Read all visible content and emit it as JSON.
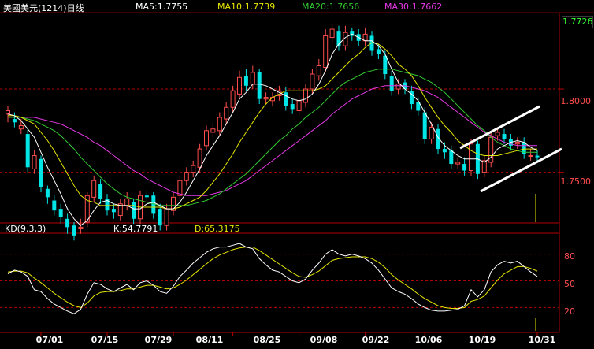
{
  "header": {
    "title": "美國美元(1214)日线",
    "ma5": "MA5:1.7755",
    "ma10": "MA10:1.7739",
    "ma20": "MA20:1.7656",
    "ma30": "MA30:1.7662"
  },
  "price_axis": {
    "current": "1.7726",
    "tick_1800": "1.8000",
    "tick_1750": "1.7500"
  },
  "kd_panel": {
    "title": "KD(9,3,3)",
    "k_text": "K:54.7791",
    "d_text": "D:65.3175",
    "ticks": [
      "80",
      "50",
      "20"
    ]
  },
  "x_ticks": [
    "07/01",
    "07/15",
    "07/29",
    "08/11",
    "08/25",
    "09/08",
    "09/22",
    "10/06",
    "10/19",
    "10/31"
  ],
  "colors": {
    "background": "#000000",
    "up": "#ff4d4d",
    "down": "#00e5e5",
    "ma5": "#ffffff",
    "ma10": "#e6e600",
    "ma20": "#33cc33",
    "ma30": "#e639e6",
    "grid": "#b40000"
  },
  "chart_data": [
    {
      "type": "candlestick",
      "title": "美國美元(1214)日线",
      "ylim": [
        1.72,
        1.845
      ],
      "yticks": [
        1.75,
        1.8
      ],
      "open": [
        1.785,
        1.782,
        1.776,
        1.773,
        1.752,
        1.758,
        1.74,
        1.733,
        1.728,
        1.722,
        1.718,
        1.716,
        1.72,
        1.735,
        1.743,
        1.734,
        1.728,
        1.724,
        1.73,
        1.732,
        1.722,
        1.736,
        1.736,
        1.728,
        1.718,
        1.727,
        1.736,
        1.745,
        1.75,
        1.753,
        1.766,
        1.774,
        1.775,
        1.782,
        1.789,
        1.797,
        1.808,
        1.803,
        1.81,
        1.794,
        1.793,
        1.796,
        1.798,
        1.791,
        1.787,
        1.792,
        1.8,
        1.808,
        1.813,
        1.831,
        1.835,
        1.826,
        1.835,
        1.833,
        1.829,
        1.832,
        1.824,
        1.82,
        1.808,
        1.8,
        1.804,
        1.799,
        1.792,
        1.786,
        1.77,
        1.776,
        1.764,
        1.763,
        1.755,
        1.755,
        1.751,
        1.767,
        1.75,
        1.756,
        1.772,
        1.773,
        1.77,
        1.767,
        1.768,
        1.76,
        1.76
      ],
      "close": [
        1.787,
        1.78,
        1.778,
        1.753,
        1.76,
        1.741,
        1.735,
        1.727,
        1.723,
        1.717,
        1.712,
        1.717,
        1.736,
        1.745,
        1.734,
        1.727,
        1.726,
        1.731,
        1.734,
        1.722,
        1.736,
        1.735,
        1.725,
        1.718,
        1.728,
        1.735,
        1.745,
        1.75,
        1.754,
        1.764,
        1.775,
        1.776,
        1.783,
        1.789,
        1.799,
        1.807,
        1.802,
        1.81,
        1.794,
        1.795,
        1.795,
        1.799,
        1.79,
        1.788,
        1.793,
        1.8,
        1.809,
        1.814,
        1.832,
        1.836,
        1.826,
        1.834,
        1.832,
        1.829,
        1.833,
        1.823,
        1.821,
        1.809,
        1.799,
        1.803,
        1.8,
        1.791,
        1.787,
        1.77,
        1.777,
        1.764,
        1.762,
        1.755,
        1.756,
        1.751,
        1.767,
        1.749,
        1.757,
        1.771,
        1.774,
        1.77,
        1.766,
        1.768,
        1.761,
        1.76,
        1.759
      ],
      "high": [
        1.79,
        1.786,
        1.782,
        1.776,
        1.763,
        1.76,
        1.742,
        1.736,
        1.731,
        1.725,
        1.72,
        1.722,
        1.738,
        1.748,
        1.746,
        1.737,
        1.731,
        1.734,
        1.738,
        1.734,
        1.739,
        1.739,
        1.738,
        1.731,
        1.731,
        1.738,
        1.748,
        1.753,
        1.757,
        1.767,
        1.778,
        1.78,
        1.786,
        1.792,
        1.802,
        1.811,
        1.812,
        1.814,
        1.812,
        1.798,
        1.798,
        1.802,
        1.801,
        1.794,
        1.796,
        1.803,
        1.812,
        1.818,
        1.836,
        1.839,
        1.838,
        1.838,
        1.837,
        1.836,
        1.837,
        1.835,
        1.827,
        1.823,
        1.811,
        1.806,
        1.806,
        1.802,
        1.795,
        1.789,
        1.78,
        1.779,
        1.768,
        1.766,
        1.759,
        1.759,
        1.77,
        1.769,
        1.76,
        1.774,
        1.777,
        1.776,
        1.773,
        1.771,
        1.771,
        1.764,
        1.763
      ],
      "low": [
        1.78,
        1.777,
        1.773,
        1.75,
        1.749,
        1.738,
        1.731,
        1.724,
        1.719,
        1.713,
        1.709,
        1.713,
        1.717,
        1.732,
        1.731,
        1.724,
        1.722,
        1.721,
        1.727,
        1.719,
        1.719,
        1.732,
        1.722,
        1.715,
        1.715,
        1.724,
        1.733,
        1.742,
        1.747,
        1.75,
        1.763,
        1.771,
        1.772,
        1.779,
        1.786,
        1.794,
        1.799,
        1.8,
        1.791,
        1.791,
        1.79,
        1.793,
        1.787,
        1.785,
        1.784,
        1.789,
        1.797,
        1.805,
        1.81,
        1.828,
        1.823,
        1.823,
        1.829,
        1.826,
        1.826,
        1.82,
        1.818,
        1.806,
        1.796,
        1.797,
        1.797,
        1.788,
        1.784,
        1.767,
        1.767,
        1.761,
        1.758,
        1.752,
        1.752,
        1.748,
        1.748,
        1.746,
        1.747,
        1.753,
        1.769,
        1.767,
        1.763,
        1.764,
        1.758,
        1.757,
        1.756
      ],
      "ma5": [
        1.785,
        1.784,
        1.781,
        1.776,
        1.771,
        1.762,
        1.753,
        1.745,
        1.737,
        1.728,
        1.722,
        1.718,
        1.721,
        1.727,
        1.732,
        1.733,
        1.731,
        1.73,
        1.73,
        1.728,
        1.728,
        1.731,
        1.732,
        1.73,
        1.728,
        1.728,
        1.732,
        1.738,
        1.745,
        1.752,
        1.76,
        1.766,
        1.772,
        1.779,
        1.786,
        1.794,
        1.798,
        1.803,
        1.803,
        1.802,
        1.8,
        1.798,
        1.796,
        1.794,
        1.793,
        1.794,
        1.797,
        1.803,
        1.811,
        1.821,
        1.827,
        1.831,
        1.833,
        1.831,
        1.829,
        1.829,
        1.826,
        1.821,
        1.812,
        1.804,
        1.8,
        1.797,
        1.793,
        1.786,
        1.779,
        1.771,
        1.766,
        1.763,
        1.76,
        1.758,
        1.758,
        1.758,
        1.756,
        1.759,
        1.764,
        1.766,
        1.768,
        1.769,
        1.768,
        1.765,
        1.763
      ],
      "ma10": [
        1.784,
        1.784,
        1.783,
        1.781,
        1.779,
        1.774,
        1.769,
        1.763,
        1.756,
        1.749,
        1.742,
        1.736,
        1.733,
        1.732,
        1.73,
        1.73,
        1.73,
        1.73,
        1.73,
        1.73,
        1.729,
        1.729,
        1.729,
        1.729,
        1.728,
        1.728,
        1.729,
        1.731,
        1.733,
        1.735,
        1.739,
        1.744,
        1.749,
        1.755,
        1.761,
        1.768,
        1.774,
        1.78,
        1.786,
        1.791,
        1.795,
        1.797,
        1.799,
        1.799,
        1.799,
        1.799,
        1.799,
        1.8,
        1.802,
        1.806,
        1.81,
        1.814,
        1.818,
        1.821,
        1.825,
        1.828,
        1.827,
        1.824,
        1.82,
        1.815,
        1.812,
        1.808,
        1.802,
        1.795,
        1.789,
        1.783,
        1.778,
        1.774,
        1.769,
        1.766,
        1.763,
        1.761,
        1.76,
        1.76,
        1.76,
        1.761,
        1.762,
        1.763,
        1.764,
        1.764,
        1.764
      ],
      "ma20": [
        1.783,
        1.783,
        1.783,
        1.782,
        1.781,
        1.779,
        1.777,
        1.775,
        1.772,
        1.768,
        1.764,
        1.759,
        1.755,
        1.751,
        1.747,
        1.743,
        1.74,
        1.737,
        1.735,
        1.734,
        1.733,
        1.732,
        1.731,
        1.73,
        1.73,
        1.73,
        1.73,
        1.73,
        1.731,
        1.732,
        1.733,
        1.735,
        1.737,
        1.74,
        1.743,
        1.746,
        1.749,
        1.753,
        1.757,
        1.761,
        1.765,
        1.769,
        1.772,
        1.776,
        1.779,
        1.783,
        1.786,
        1.789,
        1.793,
        1.797,
        1.801,
        1.804,
        1.806,
        1.808,
        1.81,
        1.811,
        1.812,
        1.812,
        1.812,
        1.811,
        1.81,
        1.809,
        1.808,
        1.806,
        1.804,
        1.801,
        1.798,
        1.794,
        1.79,
        1.786,
        1.782,
        1.778,
        1.775,
        1.771,
        1.768,
        1.766,
        1.764,
        1.763,
        1.762,
        1.762,
        1.762
      ],
      "ma30": [
        1.783,
        1.783,
        1.783,
        1.783,
        1.783,
        1.782,
        1.781,
        1.78,
        1.779,
        1.777,
        1.775,
        1.773,
        1.771,
        1.768,
        1.766,
        1.763,
        1.76,
        1.757,
        1.754,
        1.751,
        1.749,
        1.746,
        1.744,
        1.742,
        1.74,
        1.738,
        1.737,
        1.736,
        1.736,
        1.736,
        1.736,
        1.737,
        1.738,
        1.739,
        1.741,
        1.743,
        1.745,
        1.748,
        1.751,
        1.754,
        1.757,
        1.76,
        1.763,
        1.766,
        1.769,
        1.772,
        1.775,
        1.778,
        1.781,
        1.785,
        1.788,
        1.791,
        1.794,
        1.796,
        1.798,
        1.8,
        1.801,
        1.802,
        1.802,
        1.802,
        1.802,
        1.801,
        1.8,
        1.799,
        1.797,
        1.795,
        1.792,
        1.789,
        1.786,
        1.783,
        1.78,
        1.777,
        1.774,
        1.772,
        1.77,
        1.768,
        1.767,
        1.766,
        1.766,
        1.766,
        1.766
      ]
    },
    {
      "type": "line",
      "title": "KD(9,3,3)",
      "ylim": [
        0,
        100
      ],
      "yticks": [
        20,
        50,
        80
      ],
      "series": [
        {
          "name": "K",
          "values": [
            58,
            62,
            60,
            55,
            40,
            38,
            30,
            24,
            20,
            16,
            13,
            18,
            35,
            48,
            46,
            41,
            38,
            42,
            46,
            40,
            48,
            50,
            45,
            38,
            36,
            44,
            55,
            62,
            70,
            76,
            82,
            86,
            88,
            88,
            90,
            92,
            88,
            86,
            75,
            68,
            62,
            60,
            55,
            50,
            48,
            52,
            62,
            70,
            80,
            85,
            80,
            78,
            80,
            78,
            75,
            70,
            62,
            52,
            42,
            38,
            35,
            30,
            24,
            20,
            17,
            16,
            16,
            17,
            18,
            22,
            40,
            32,
            40,
            60,
            68,
            72,
            70,
            72,
            66,
            60,
            55
          ]
        },
        {
          "name": "D",
          "values": [
            60,
            61,
            61,
            59,
            53,
            48,
            42,
            36,
            31,
            26,
            22,
            20,
            25,
            33,
            37,
            38,
            38,
            39,
            41,
            41,
            43,
            45,
            45,
            43,
            41,
            42,
            46,
            51,
            57,
            63,
            69,
            75,
            79,
            82,
            85,
            87,
            88,
            88,
            84,
            79,
            74,
            69,
            64,
            59,
            55,
            54,
            57,
            61,
            67,
            73,
            75,
            76,
            77,
            77,
            77,
            75,
            71,
            65,
            57,
            51,
            46,
            41,
            35,
            30,
            26,
            22,
            20,
            19,
            19,
            20,
            27,
            29,
            33,
            42,
            51,
            58,
            62,
            66,
            66,
            64,
            61
          ]
        }
      ]
    }
  ]
}
